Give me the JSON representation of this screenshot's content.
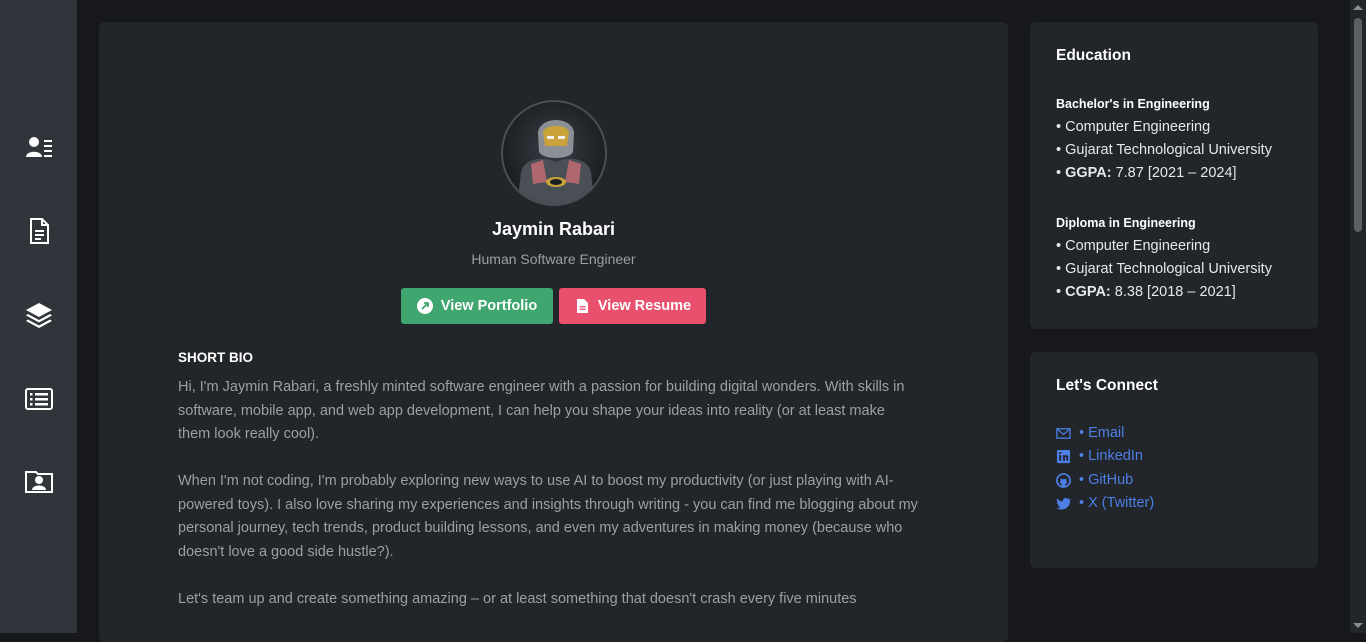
{
  "profile": {
    "name": "Jaymin Rabari",
    "subtitle": "Human Software Engineer",
    "portfolio_label": "View Portfolio",
    "resume_label": "View Resume"
  },
  "bio": {
    "heading": "SHORT BIO",
    "paragraphs": [
      "Hi, I'm Jaymin Rabari, a freshly minted software engineer with a passion for building digital wonders. With skills in software, mobile app, and web app development, I can help you shape your ideas into reality (or at least make them look really cool).",
      "When I'm not coding, I'm probably exploring new ways to use AI to boost my productivity (or just playing with AI-powered toys). I also love sharing my experiences and insights through writing - you can find me blogging about my personal journey, tech trends, product building lessons, and even my adventures in making money (because who doesn't love a good side hustle?).",
      "Let's team up and create something amazing – or at least something that doesn't crash every five minutes"
    ]
  },
  "education": {
    "title": "Education",
    "degrees": [
      {
        "degree": "Bachelor's in Engineering",
        "field": "• Computer Engineering",
        "university": "• Gujarat Technological University",
        "score_label": "GGPA:",
        "score_value": "7.87 [2021 – 2024]"
      },
      {
        "degree": "Diploma in Engineering",
        "field": "• Computer Engineering",
        "university": "• Gujarat Technological University",
        "score_label": "CGPA:",
        "score_value": "8.38 [2018 – 2021]"
      }
    ]
  },
  "connect": {
    "title": "Let's Connect",
    "links": [
      {
        "label": "• Email",
        "icon": "email-icon"
      },
      {
        "label": "• LinkedIn",
        "icon": "linkedin-icon"
      },
      {
        "label": "• GitHub",
        "icon": "github-icon"
      },
      {
        "label": "• X (Twitter)",
        "icon": "twitter-icon"
      }
    ]
  },
  "sidebar": {
    "items": [
      {
        "icon": "profile-list-icon"
      },
      {
        "icon": "document-icon"
      },
      {
        "icon": "layers-icon"
      },
      {
        "icon": "list-box-icon"
      },
      {
        "icon": "contact-folder-icon"
      }
    ]
  },
  "colors": {
    "background": "#16181b",
    "sidebar": "#30353b",
    "card": "#222529",
    "portfolio_button": "#3fa66f",
    "resume_button": "#e8506e",
    "link": "#4d7fe6"
  }
}
